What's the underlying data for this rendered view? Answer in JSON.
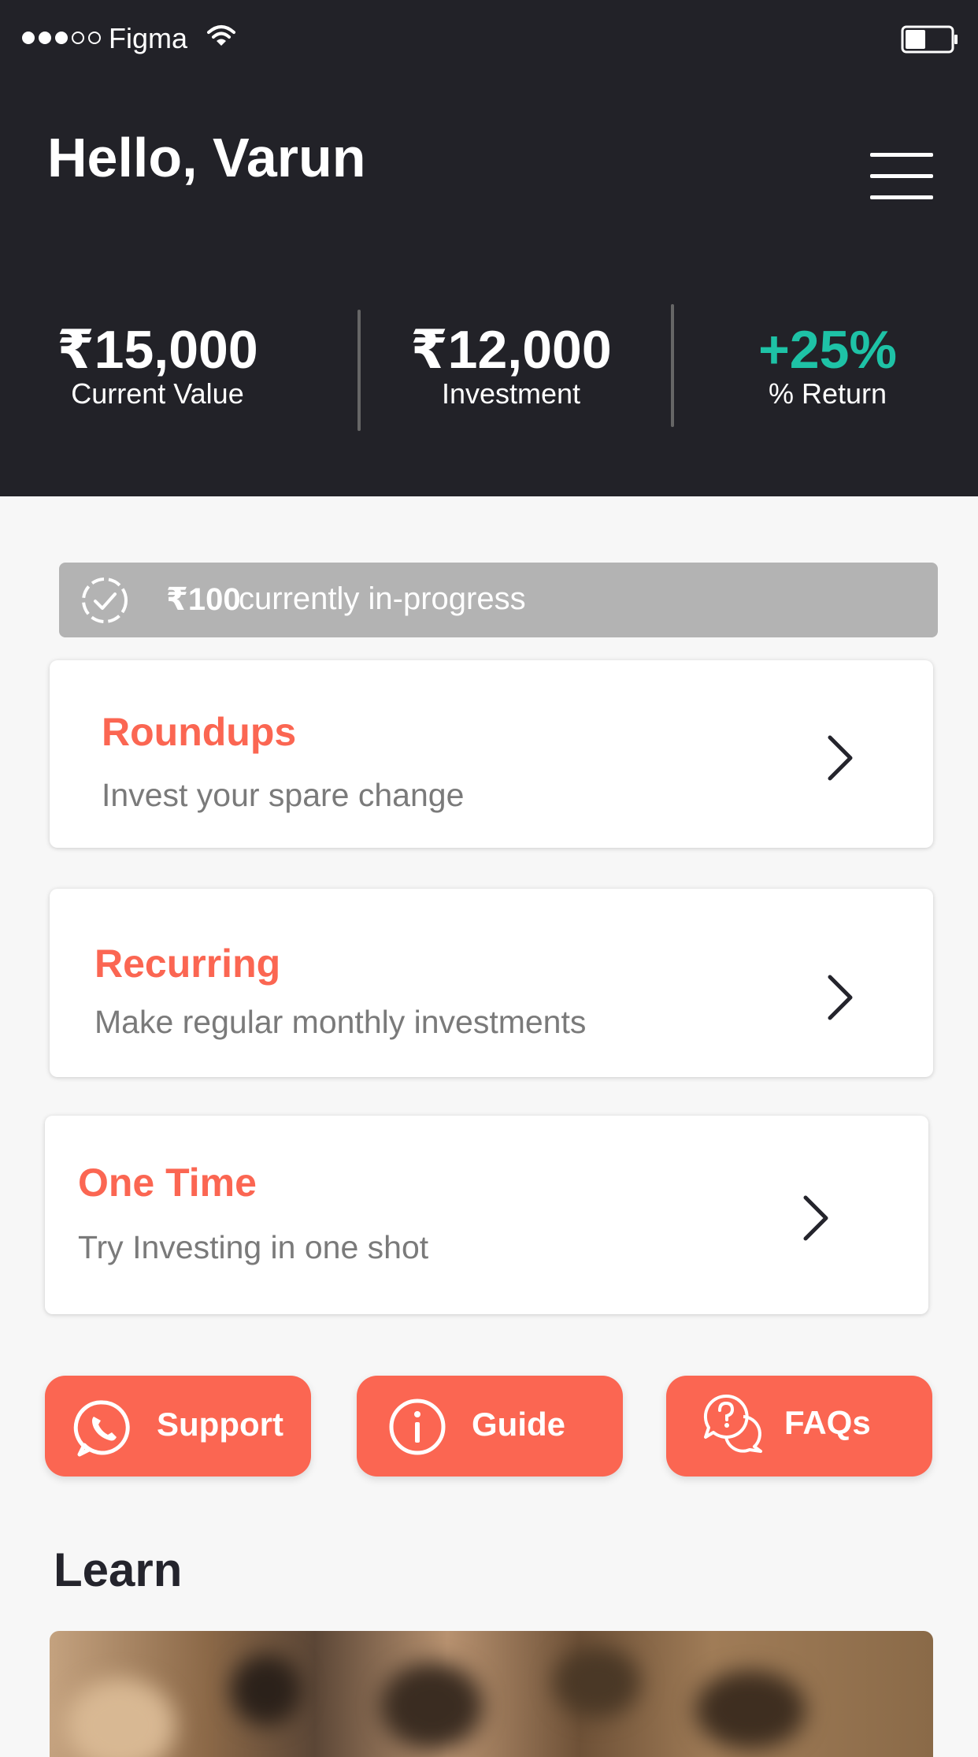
{
  "status_bar": {
    "carrier": "Figma",
    "signal_bars_filled": 3,
    "signal_bars_total": 5,
    "wifi_icon": "wifi-icon",
    "battery_icon": "battery-icon",
    "battery_level": 0.45
  },
  "header": {
    "greeting": "Hello, Varun",
    "menu_icon": "hamburger-menu-icon"
  },
  "stats": [
    {
      "value": "₹15,000",
      "label": "Current Value"
    },
    {
      "value": "₹12,000",
      "label": "Investment"
    },
    {
      "value": "+25%",
      "label": "% Return",
      "color": "#1ec2a6"
    }
  ],
  "progress": {
    "icon": "progress-check-icon",
    "amount": "₹100",
    "text": "currently in-progress"
  },
  "cards": [
    {
      "title": "Roundups",
      "subtitle": "Invest your spare change"
    },
    {
      "title": "Recurring",
      "subtitle": "Make regular monthly investments"
    },
    {
      "title": "One Time",
      "subtitle": "Try Investing in one shot"
    }
  ],
  "actions": [
    {
      "label": "Support",
      "icon": "whatsapp-icon"
    },
    {
      "label": "Guide",
      "icon": "info-icon"
    },
    {
      "label": "FAQs",
      "icon": "faq-chat-icon"
    }
  ],
  "learn": {
    "title": "Learn"
  },
  "colors": {
    "header_bg": "#222228",
    "accent": "#fb6652",
    "positive": "#1ec2a6",
    "progress_bg": "#b3b3b3",
    "page_bg": "#f7f7f7"
  }
}
